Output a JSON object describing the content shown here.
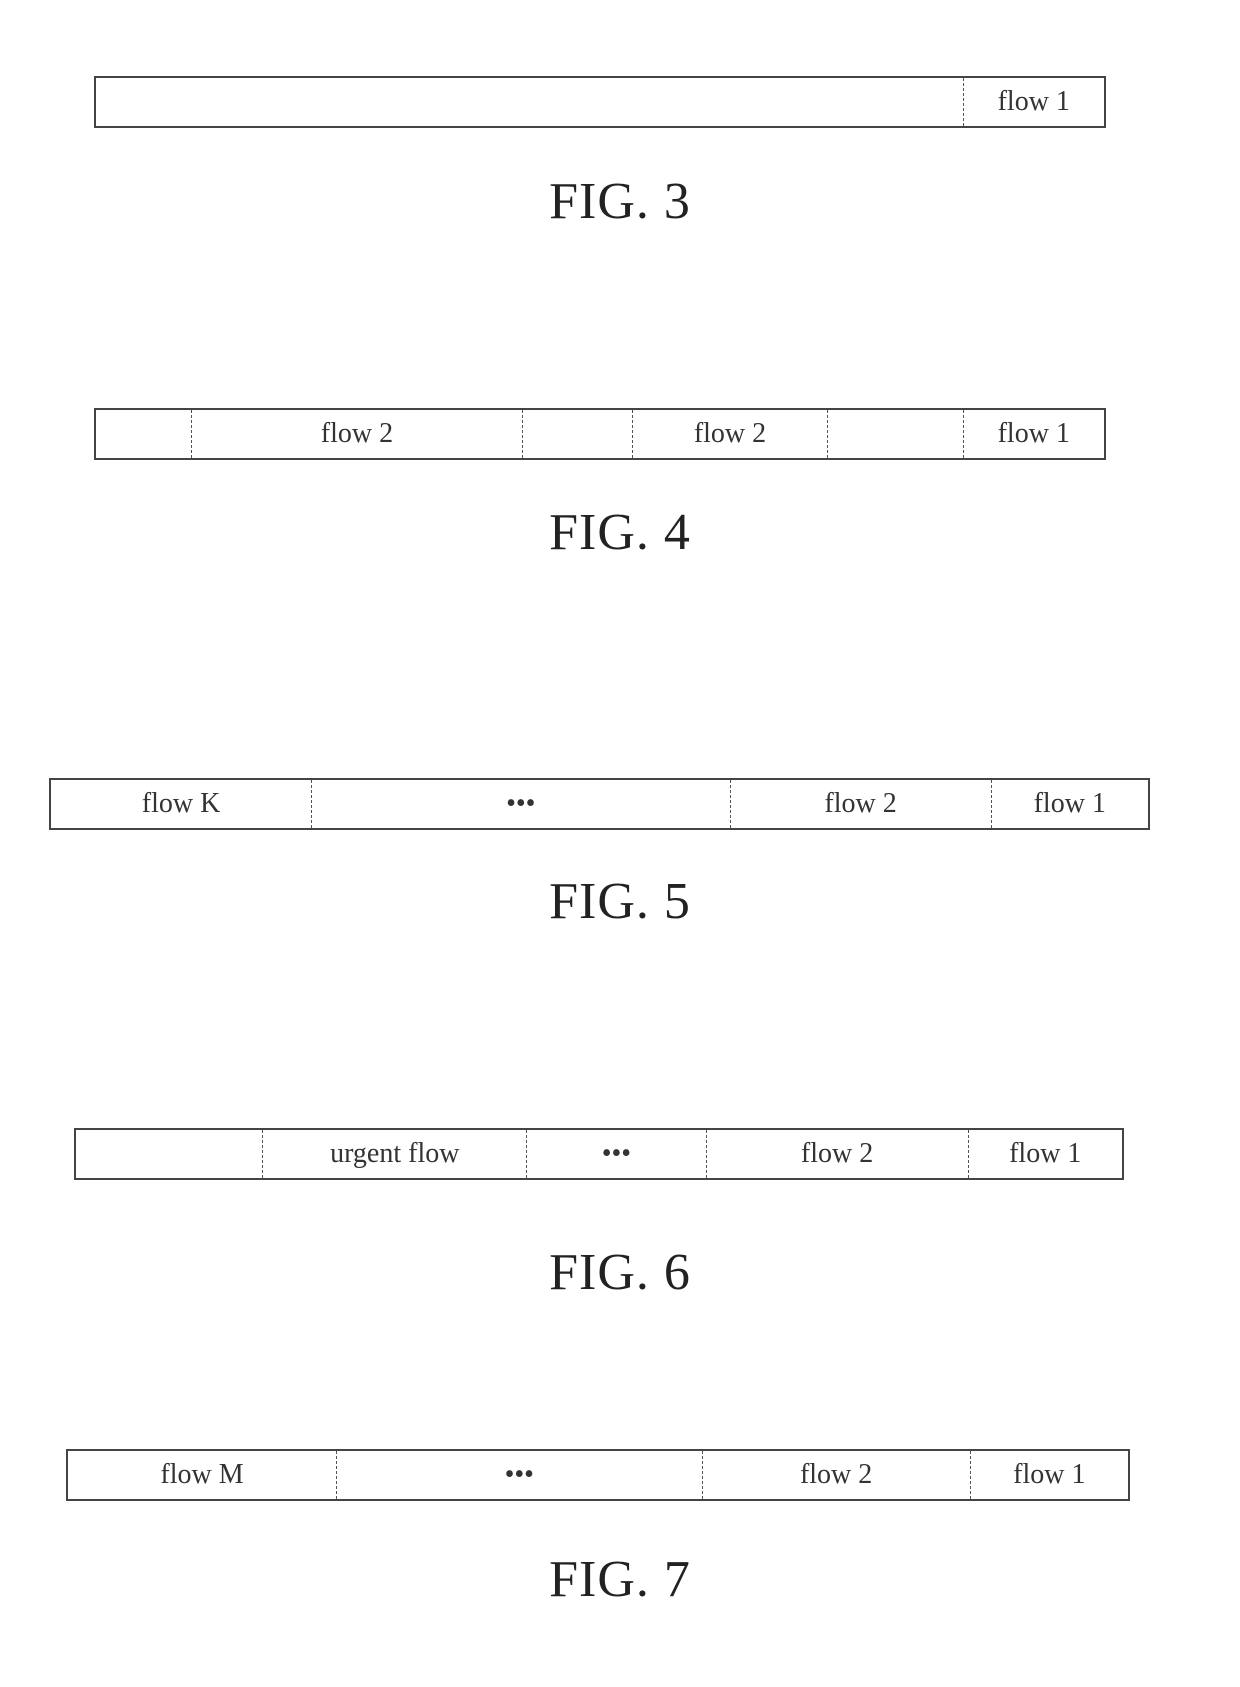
{
  "figures": [
    {
      "caption": "FIG. 3",
      "cells": [
        {
          "label": ""
        },
        {
          "label": "flow 1"
        }
      ]
    },
    {
      "caption": "FIG. 4",
      "cells": [
        {
          "label": ""
        },
        {
          "label": "flow 2"
        },
        {
          "label": ""
        },
        {
          "label": "flow 2"
        },
        {
          "label": ""
        },
        {
          "label": "flow 1"
        }
      ]
    },
    {
      "caption": "FIG. 5",
      "cells": [
        {
          "label": "flow K"
        },
        {
          "label": "•••"
        },
        {
          "label": "flow 2"
        },
        {
          "label": "flow 1"
        }
      ]
    },
    {
      "caption": "FIG. 6",
      "cells": [
        {
          "label": ""
        },
        {
          "label": "urgent flow"
        },
        {
          "label": "•••"
        },
        {
          "label": "flow 2"
        },
        {
          "label": "flow 1"
        }
      ]
    },
    {
      "caption": "FIG. 7",
      "cells": [
        {
          "label": "flow M"
        },
        {
          "label": "•••"
        },
        {
          "label": "flow 2"
        },
        {
          "label": "flow 1"
        }
      ]
    }
  ]
}
